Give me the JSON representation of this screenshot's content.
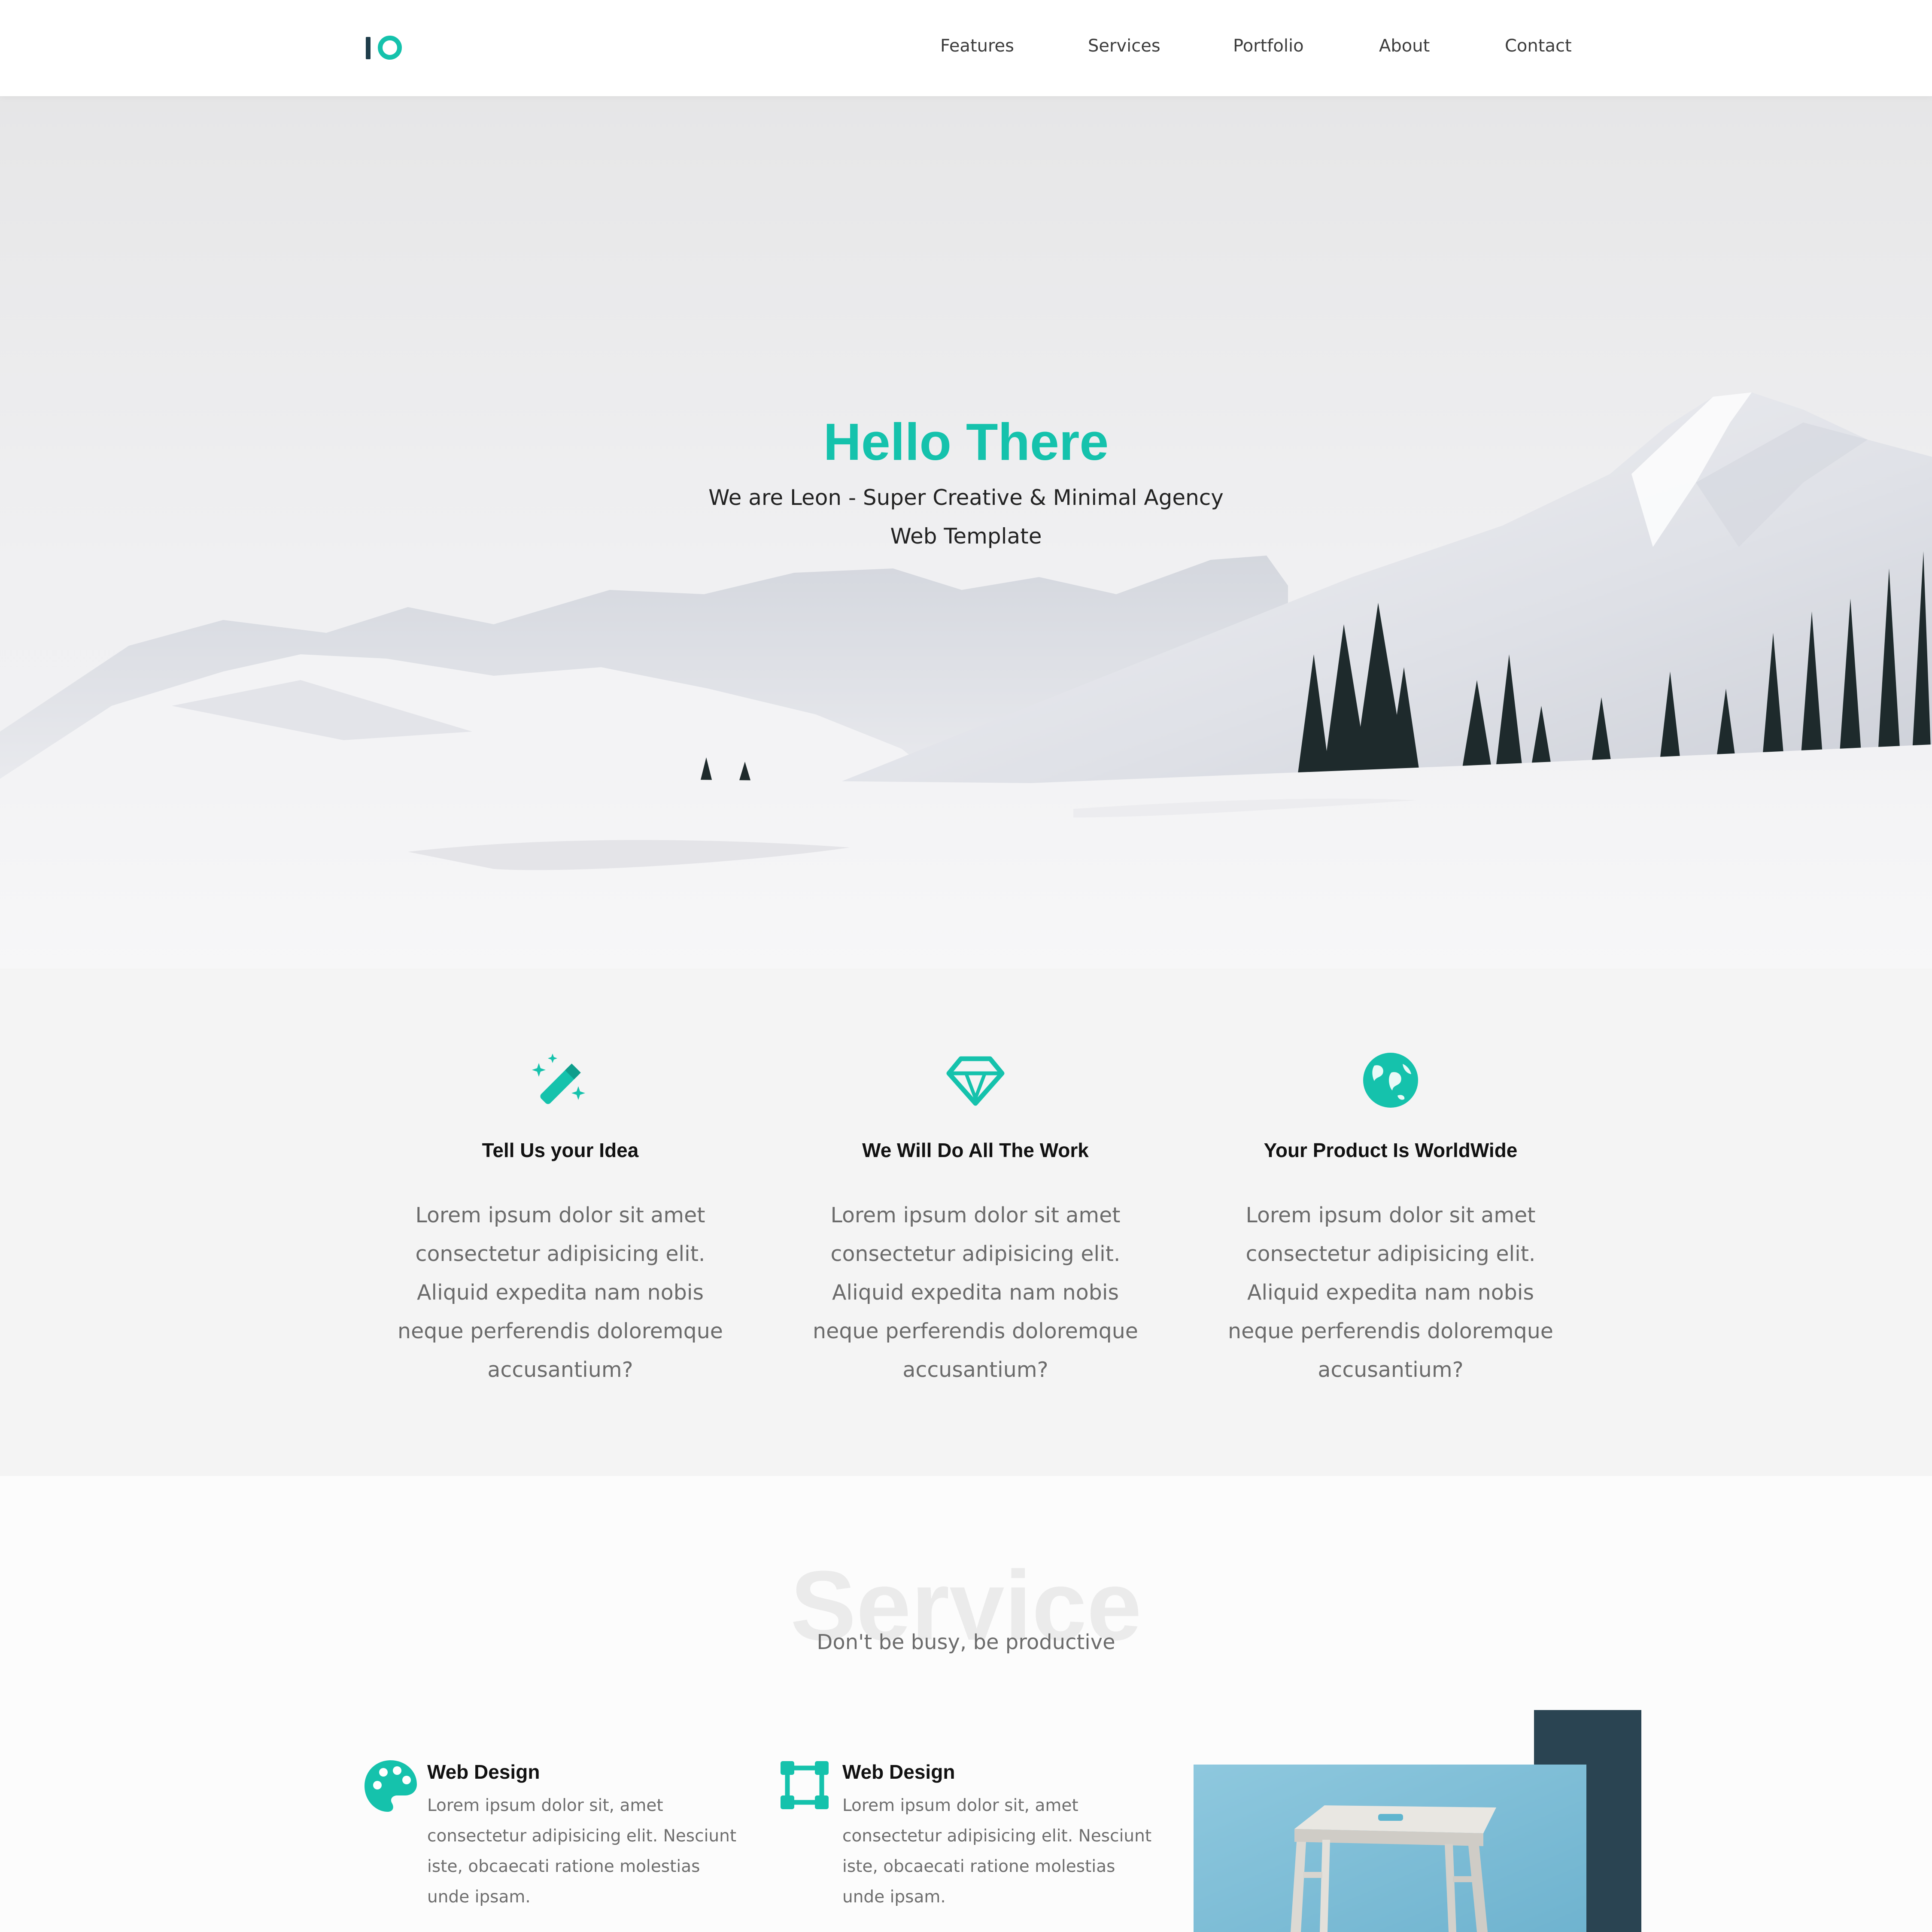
{
  "header": {
    "nav": [
      {
        "label": "Features"
      },
      {
        "label": "Services"
      },
      {
        "label": "Portfolio"
      },
      {
        "label": "About"
      },
      {
        "label": "Contact"
      }
    ]
  },
  "hero": {
    "title": "Hello There",
    "subtitle": "We are Leon - Super Creative & Minimal Agency Web Template"
  },
  "features": [
    {
      "icon": "magic-wand-icon",
      "title": "Tell Us your Idea",
      "text": "Lorem ipsum dolor sit amet consectetur adipisicing elit. Aliquid expedita nam nobis neque perferendis doloremque accusantium?"
    },
    {
      "icon": "diamond-icon",
      "title": "We Will Do All The Work",
      "text": "Lorem ipsum dolor sit amet consectetur adipisicing elit. Aliquid expedita nam nobis neque perferendis doloremque accusantium?"
    },
    {
      "icon": "globe-icon",
      "title": "Your Product Is WorldWide",
      "text": "Lorem ipsum dolor sit amet consectetur adipisicing elit. Aliquid expedita nam nobis neque perferendis doloremque accusantium?"
    }
  ],
  "service": {
    "bg_word": "Service",
    "subtitle": "Don't be busy, be productive",
    "items": [
      {
        "icon": "palette-icon",
        "title": "Web Design",
        "text": "Lorem ipsum dolor sit, amet consectetur adipisicing elit. Nesciunt iste, obcaecati ratione molestias unde ipsam."
      },
      {
        "icon": "vector-square-icon",
        "title": "Web Design",
        "text": "Lorem ipsum dolor sit, amet consectetur adipisicing elit. Nesciunt iste, obcaecati ratione molestias unde ipsam."
      }
    ]
  },
  "colors": {
    "accent": "#15c2ac",
    "dark": "#2a4452",
    "section_bg": "#f4f4f4"
  }
}
